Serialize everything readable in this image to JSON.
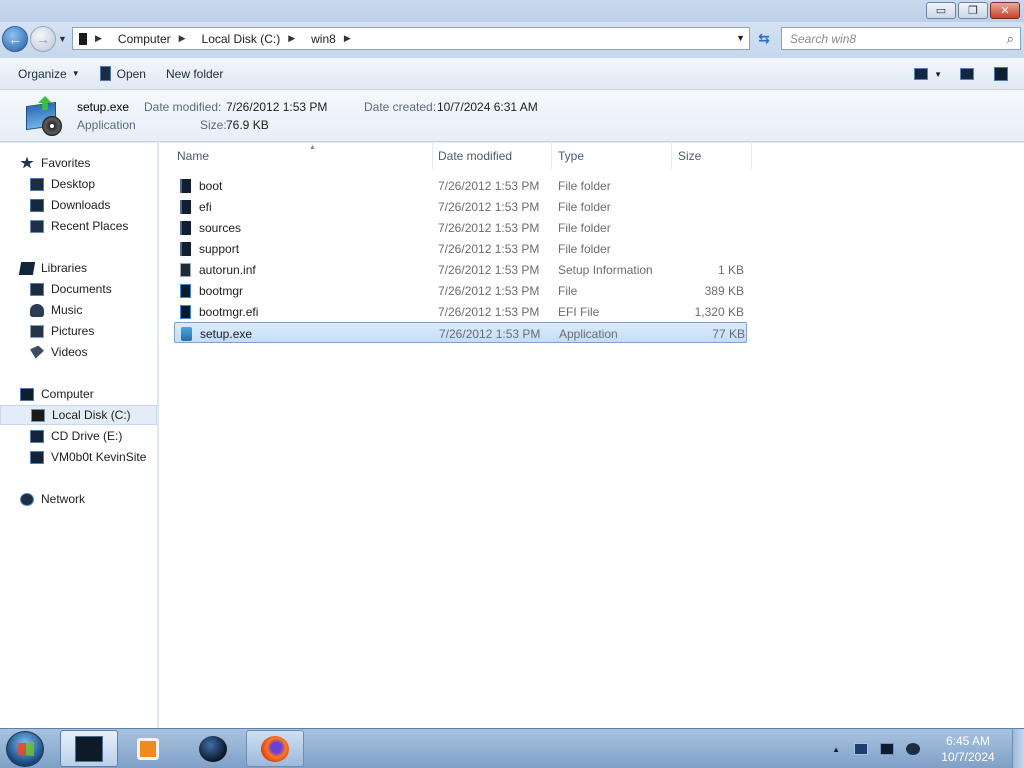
{
  "window": {
    "buttons": {
      "minimize": "▭",
      "restore": "❐",
      "close": "✕"
    }
  },
  "address": {
    "crumbs": [
      "Computer",
      "Local Disk (C:)",
      "win8"
    ],
    "search_placeholder": "Search win8"
  },
  "toolbar": {
    "organize_label": "Organize",
    "open_label": "Open",
    "new_folder_label": "New folder"
  },
  "details": {
    "name": "setup.exe",
    "type": "Application",
    "date_modified_label": "Date modified:",
    "date_modified": "7/26/2012 1:53 PM",
    "date_created_label": "Date created:",
    "date_created": "10/7/2024 6:31 AM",
    "size_label": "Size:",
    "size": "76.9 KB"
  },
  "nav": {
    "favorites": {
      "label": "Favorites",
      "items": [
        "Desktop",
        "Downloads",
        "Recent Places"
      ]
    },
    "libraries": {
      "label": "Libraries",
      "items": [
        "Documents",
        "Music",
        "Pictures",
        "Videos"
      ]
    },
    "computer": {
      "label": "Computer",
      "items": [
        "Local Disk (C:)",
        "CD Drive (E:)",
        "VM0b0t KevinSite"
      ],
      "selected": "Local Disk (C:)"
    },
    "network": {
      "label": "Network"
    }
  },
  "files": {
    "columns": [
      "Name",
      "Date modified",
      "Type",
      "Size"
    ],
    "rows": [
      {
        "name": "boot",
        "date": "7/26/2012 1:53 PM",
        "type": "File folder",
        "size": "",
        "icon": "folder-icon"
      },
      {
        "name": "efi",
        "date": "7/26/2012 1:53 PM",
        "type": "File folder",
        "size": "",
        "icon": "folder-icon"
      },
      {
        "name": "sources",
        "date": "7/26/2012 1:53 PM",
        "type": "File folder",
        "size": "",
        "icon": "folder-icon"
      },
      {
        "name": "support",
        "date": "7/26/2012 1:53 PM",
        "type": "File folder",
        "size": "",
        "icon": "folder-icon"
      },
      {
        "name": "autorun.inf",
        "date": "7/26/2012 1:53 PM",
        "type": "Setup Information",
        "size": "1 KB",
        "icon": "setup-info-icon"
      },
      {
        "name": "bootmgr",
        "date": "7/26/2012 1:53 PM",
        "type": "File",
        "size": "389 KB",
        "icon": "file-icon"
      },
      {
        "name": "bootmgr.efi",
        "date": "7/26/2012 1:53 PM",
        "type": "EFI File",
        "size": "1,320 KB",
        "icon": "file-icon"
      },
      {
        "name": "setup.exe",
        "date": "7/26/2012 1:53 PM",
        "type": "Application",
        "size": "77 KB",
        "icon": "setup-exe-icon"
      }
    ],
    "selected": "setup.exe"
  },
  "taskbar": {
    "time": "6:45 AM",
    "date": "10/7/2024"
  },
  "colors": {
    "selection_bg": "#c4ddfa",
    "selection_border": "#7da2ce",
    "taskbar": "#7fa0c7"
  }
}
